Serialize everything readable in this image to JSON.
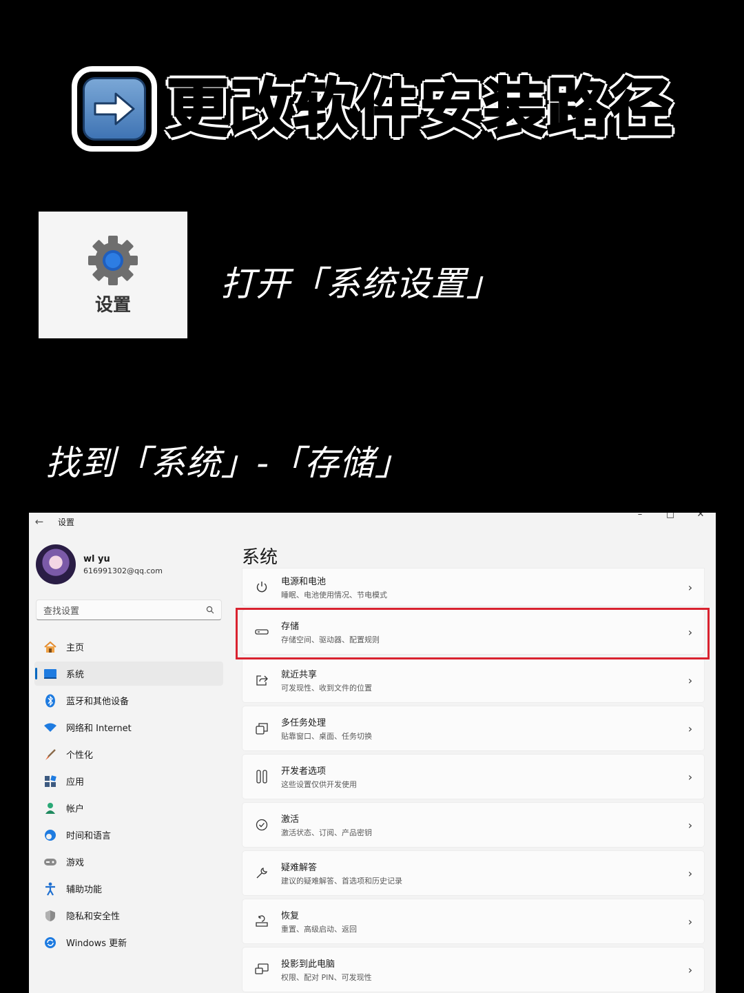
{
  "title": {
    "text": "更改软件安装路径",
    "badge_icon": "right-arrow-icon"
  },
  "app_tile": {
    "label": "设置",
    "icon": "gear-icon"
  },
  "captions": {
    "step1": "打开「系统设置」",
    "step2": "找到「系统」-「存储」"
  },
  "window": {
    "app_name": "设置",
    "controls": [
      "–",
      "□",
      "✕"
    ],
    "profile": {
      "name": "wl yu",
      "email": "616991302@qq.com"
    },
    "search": {
      "placeholder": "查找设置"
    },
    "nav": [
      {
        "label": "主页",
        "icon": "home-icon"
      },
      {
        "label": "系统",
        "icon": "monitor-icon",
        "active": true
      },
      {
        "label": "蓝牙和其他设备",
        "icon": "bluetooth-icon"
      },
      {
        "label": "网络和 Internet",
        "icon": "wifi-icon"
      },
      {
        "label": "个性化",
        "icon": "brush-icon"
      },
      {
        "label": "应用",
        "icon": "apps-icon"
      },
      {
        "label": "帐户",
        "icon": "user-icon"
      },
      {
        "label": "时间和语言",
        "icon": "clock-globe-icon"
      },
      {
        "label": "游戏",
        "icon": "gamepad-icon"
      },
      {
        "label": "辅助功能",
        "icon": "accessibility-icon"
      },
      {
        "label": "隐私和安全性",
        "icon": "shield-icon"
      },
      {
        "label": "Windows 更新",
        "icon": "update-icon"
      }
    ],
    "page_title": "系统",
    "cards": [
      {
        "title": "电源和电池",
        "subtitle": "睡眠、电池使用情况、节电模式",
        "icon": "power-icon"
      },
      {
        "title": "存储",
        "subtitle": "存储空间、驱动器、配置规则",
        "icon": "storage-icon",
        "highlighted": true
      },
      {
        "title": "就近共享",
        "subtitle": "可发现性、收到文件的位置",
        "icon": "share-icon"
      },
      {
        "title": "多任务处理",
        "subtitle": "贴靠窗口、桌面、任务切换",
        "icon": "multitask-icon"
      },
      {
        "title": "开发者选项",
        "subtitle": "这些设置仅供开发使用",
        "icon": "developer-icon"
      },
      {
        "title": "激活",
        "subtitle": "激活状态、订阅、产品密钥",
        "icon": "check-circle-icon"
      },
      {
        "title": "疑难解答",
        "subtitle": "建议的疑难解答、首选项和历史记录",
        "icon": "wrench-icon"
      },
      {
        "title": "恢复",
        "subtitle": "重置、高级启动、返回",
        "icon": "recovery-icon"
      },
      {
        "title": "投影到此电脑",
        "subtitle": "权限、配对 PIN、可发现性",
        "icon": "project-icon"
      }
    ],
    "highlight_color": "#d9222f",
    "accent_color": "#0067c0"
  }
}
